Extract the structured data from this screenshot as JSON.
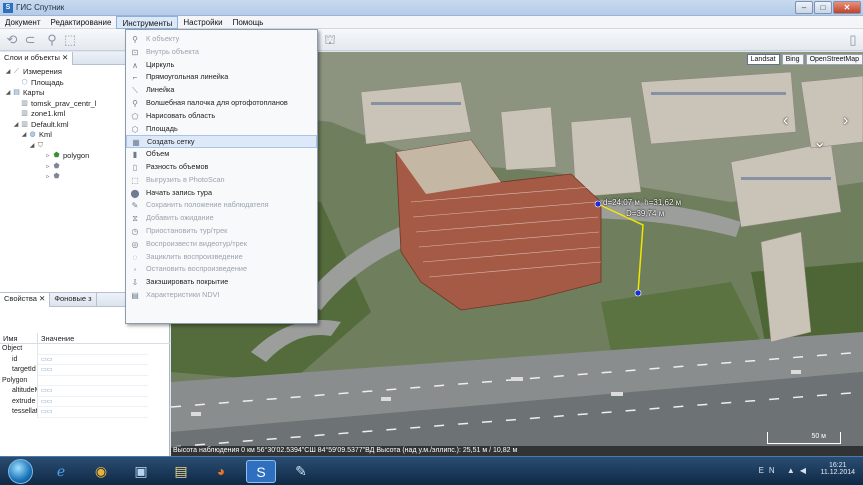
{
  "window": {
    "title": "ГИС Спутник",
    "icon_letter": "S",
    "buttons": {
      "minimize": "–",
      "maximize": "□",
      "close": "✕"
    }
  },
  "menubar": {
    "items": [
      "Документ",
      "Редактирование",
      "Инструменты",
      "Настройки",
      "Помощь"
    ],
    "active_index": 2
  },
  "left_panel": {
    "tabs": [
      {
        "label": "Слои и объекты ✕"
      },
      {
        "label": ""
      }
    ],
    "tree": [
      {
        "label": "Измерения",
        "icon": "ruler-icon"
      },
      {
        "label": "Площадь",
        "icon": "area-icon"
      },
      {
        "label": "Карты",
        "icon": "maps-icon"
      },
      {
        "label": "tomsk_prav_centr_l",
        "icon": "kml-icon"
      },
      {
        "label": "zone1.kml",
        "icon": "kml-icon"
      },
      {
        "label": "Default.kml",
        "icon": "kml-icon"
      },
      {
        "label": "Kml",
        "icon": "globe-icon"
      },
      {
        "label": "",
        "icon": "folder-icon"
      },
      {
        "label": "polygon",
        "icon": "polygon-icon"
      },
      {
        "label": "",
        "icon": "placemark-icon"
      },
      {
        "label": "",
        "icon": "placemark-icon"
      }
    ],
    "props_tabs": [
      "Свойства ✕",
      "Фоновые з"
    ],
    "props_header": {
      "name": "Имя",
      "value": "Значение"
    },
    "props": [
      {
        "key": "Object",
        "value": "",
        "group": true
      },
      {
        "key": "id",
        "value": "▭▭",
        "group": false
      },
      {
        "key": "targetId",
        "value": "▭▭",
        "group": false
      },
      {
        "key": "Polygon",
        "value": "",
        "group": true
      },
      {
        "key": "altitudeM",
        "value": "▭▭",
        "group": false
      },
      {
        "key": "extrude",
        "value": "▭▭",
        "group": false
      },
      {
        "key": "tessellate",
        "value": "▭▭",
        "group": false
      }
    ]
  },
  "tools_menu": {
    "hover_index": 8,
    "items": [
      {
        "label": "К объекту",
        "icon": "zoom-to-icon",
        "disabled": true
      },
      {
        "label": "Внутрь объекта",
        "icon": "inside-icon",
        "disabled": true
      },
      {
        "label": "Циркуль",
        "icon": "compass-icon",
        "disabled": false
      },
      {
        "label": "Прямоугольная линейка",
        "icon": "square-ruler-icon",
        "disabled": false
      },
      {
        "label": "Линейка",
        "icon": "ruler-icon",
        "disabled": false
      },
      {
        "label": "Волшебная палочка для ортофотопланов",
        "icon": "magic-wand-icon",
        "disabled": false
      },
      {
        "label": "Нарисовать область",
        "icon": "draw-area-icon",
        "disabled": false
      },
      {
        "label": "Площадь",
        "icon": "area-icon",
        "disabled": false
      },
      {
        "label": "Создать сетку",
        "icon": "grid-icon",
        "disabled": false
      },
      {
        "label": "Объем",
        "icon": "volume-icon",
        "disabled": false
      },
      {
        "label": "Разность объемов",
        "icon": "volume-diff-icon",
        "disabled": false
      },
      {
        "label": "Выгрузить в PhotoScan",
        "icon": "export-icon",
        "disabled": true
      },
      {
        "label": "Начать запись тура",
        "icon": "record-tour-icon",
        "disabled": false
      },
      {
        "label": "Сохранить положение наблюдателя",
        "icon": "save-view-icon",
        "disabled": true
      },
      {
        "label": "Добавить ожидание",
        "icon": "wait-icon",
        "disabled": true
      },
      {
        "label": "Приостановить тур/трек",
        "icon": "pause-icon",
        "disabled": true
      },
      {
        "label": "Воспроизвести видеотур/трек",
        "icon": "play-icon",
        "disabled": true
      },
      {
        "label": "Зациклить воспроизведение",
        "icon": "loop-icon",
        "disabled": true
      },
      {
        "label": "Остановить воспроизведение",
        "icon": "stop-icon",
        "disabled": true
      },
      {
        "label": "Закэшировать покрытие",
        "icon": "cache-icon",
        "disabled": false
      },
      {
        "label": "Характеристики NDVI",
        "icon": "ndvi-icon",
        "disabled": true
      }
    ]
  },
  "map": {
    "basemaps": [
      "Landsat",
      "Bing",
      "OpenStreetMap"
    ],
    "active_basemap": 0,
    "measure": {
      "label1": "d=24,07 м, h=31,62 м",
      "label2": "D=39,74 м"
    },
    "scale_label": "50 м",
    "status": "Высота наблюдения 0 км     56°30'02.5394\"СШ 84°59'09.5377\"ВД  Высота (над у.м./эллипс.): 25,51 м / 10,82 м"
  },
  "taskbar": {
    "apps": [
      "explorer-icon",
      "chrome-icon",
      "media-icon",
      "folder-icon",
      "firefox-icon",
      "sputnik-icon",
      "paint-icon"
    ],
    "tray": {
      "lang": "EN",
      "time": "16:21",
      "date": "11.12.2014"
    }
  },
  "colors": {
    "accent": "#2f6fbf",
    "measure_line": "#f2e600",
    "measure_point": "#1a2dd8"
  }
}
